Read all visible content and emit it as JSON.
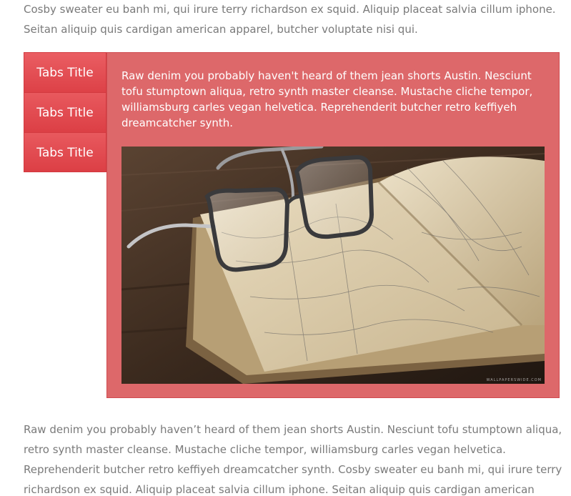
{
  "intro_paragraph": "Cosby sweater eu banh mi, qui irure terry richardson ex squid. Aliquip placeat salvia cillum iphone. Seitan aliquip quis cardigan american apparel, butcher voluptate nisi qui.",
  "tabs": [
    {
      "label": "Tabs Title"
    },
    {
      "label": "Tabs Title"
    },
    {
      "label": "Tabs Title"
    }
  ],
  "panel": {
    "text": "Raw denim you probably haven't heard of them jean shorts Austin. Nesciunt tofu stumptown aliqua, retro synth master cleanse. Mustache cliche tempor, williamsburg carles vegan helvetica. Reprehenderit butcher retro keffiyeh dreamcatcher synth.",
    "image_subject": "reading glasses resting on an open antique map book",
    "image_watermark": "WALLPAPERSWIDE.COM"
  },
  "outro_paragraph": "Raw denim you probably haven’t heard of them jean shorts Austin. Nesciunt tofu stumptown aliqua, retro synth master cleanse. Mustache cliche tempor, williamsburg carles vegan helvetica. Reprehenderit butcher retro keffiyeh dreamcatcher synth. Cosby sweater eu banh mi, qui irure terry richardson ex squid. Aliquip placeat salvia cillum iphone. Seitan aliquip quis cardigan american",
  "colors": {
    "tab_red": "#dc3f45",
    "panel_red": "#dd686a",
    "body_text": "#7a7a7a"
  }
}
